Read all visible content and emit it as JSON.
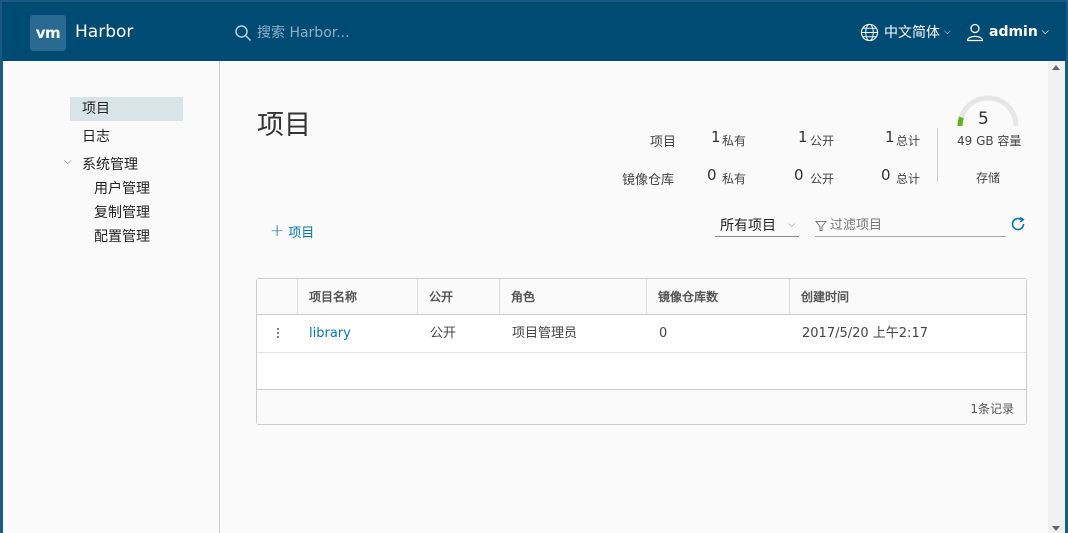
{
  "header": {
    "logo_text": "vm",
    "app_name": "Harbor",
    "search_placeholder": "搜索 Harbor...",
    "language": "中文简体",
    "user": "admin"
  },
  "sidebar": {
    "items": [
      {
        "label": "项目",
        "active": true
      },
      {
        "label": "日志"
      },
      {
        "label": "系统管理"
      }
    ],
    "admin_sub": [
      "用户管理",
      "复制管理",
      "配置管理"
    ]
  },
  "main": {
    "title": "项目",
    "stats": {
      "projects_label": "项目",
      "repos_label": "镜像仓库",
      "project_private": "1",
      "project_public": "1",
      "project_total": "1",
      "repo_private": "0",
      "repo_public": "0",
      "repo_total": "0",
      "private_label": "私有",
      "public_label": "公开",
      "total_label": "总计"
    },
    "storage": {
      "count": "5",
      "capacity": "49 GB 容量",
      "label": "存储",
      "used_fraction": 0.1
    },
    "add_project_label": "项目",
    "filter": {
      "select_value": "所有项目",
      "placeholder": "过滤项目"
    },
    "table": {
      "columns": [
        "项目名称",
        "公开",
        "角色",
        "镜像仓库数",
        "创建时间"
      ],
      "rows": [
        [
          "library",
          "公开",
          "项目管理员",
          "0",
          "2017/5/20 上午2:17"
        ]
      ],
      "footer": "1条记录"
    }
  },
  "colors": {
    "header_bg": "#004b74",
    "link": "#0077b8",
    "gauge": "#60b515"
  }
}
